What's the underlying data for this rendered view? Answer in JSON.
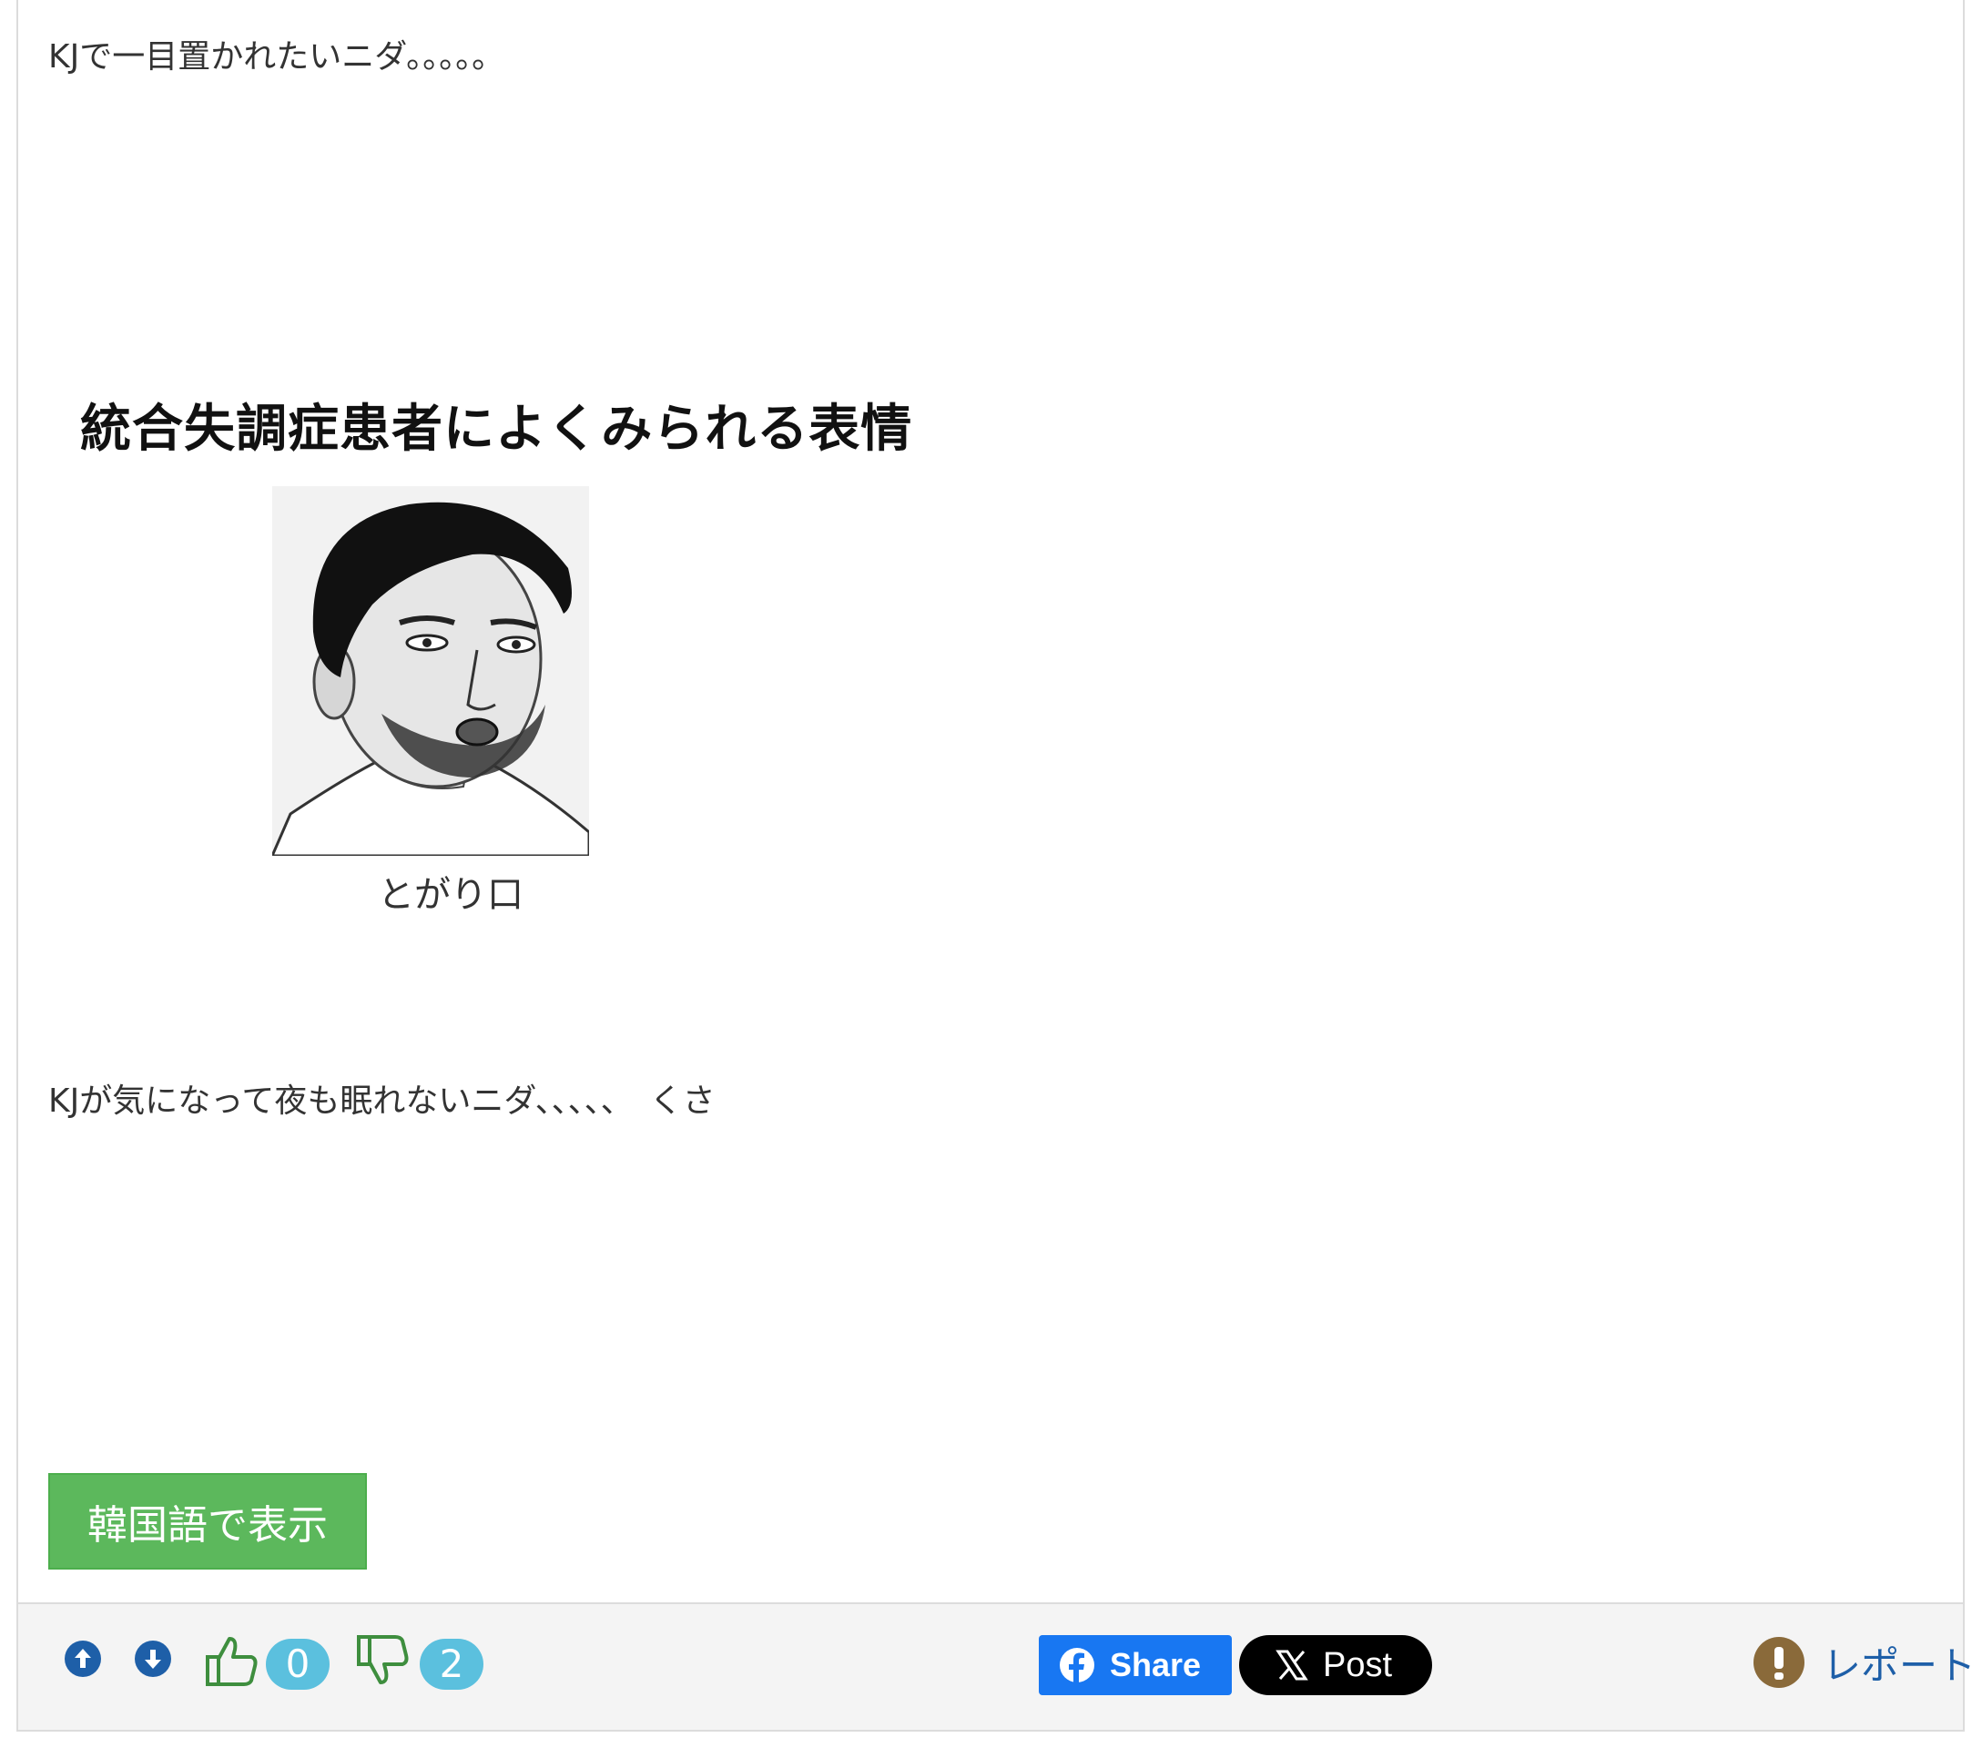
{
  "post": {
    "line_1": "KJで一目置かれたいニダ。。。。。",
    "line_2": "KJが気になって夜も眠れないニダ、、、、、　くさ"
  },
  "embedded_image": {
    "title": "統合失調症患者によくみられる表情",
    "caption": "とがり口"
  },
  "translate_button_label": "韓国語で表示",
  "toolbar": {
    "arrow_up_icon": "arrow-up-circle-icon",
    "arrow_down_icon": "arrow-down-circle-icon",
    "like_icon": "thumbs-up-icon",
    "dislike_icon": "thumbs-down-icon",
    "like_count": "0",
    "dislike_count": "2",
    "share_label": "Share",
    "post_label": "Post",
    "report_label": "レポート"
  },
  "colors": {
    "translate_button": "#5cb85c",
    "badge": "#5bc0de",
    "facebook": "#1877f2",
    "x": "#000000",
    "link": "#1e5fa8",
    "report_icon": "#8a6a3a",
    "thumb": "#3e8e3e"
  }
}
